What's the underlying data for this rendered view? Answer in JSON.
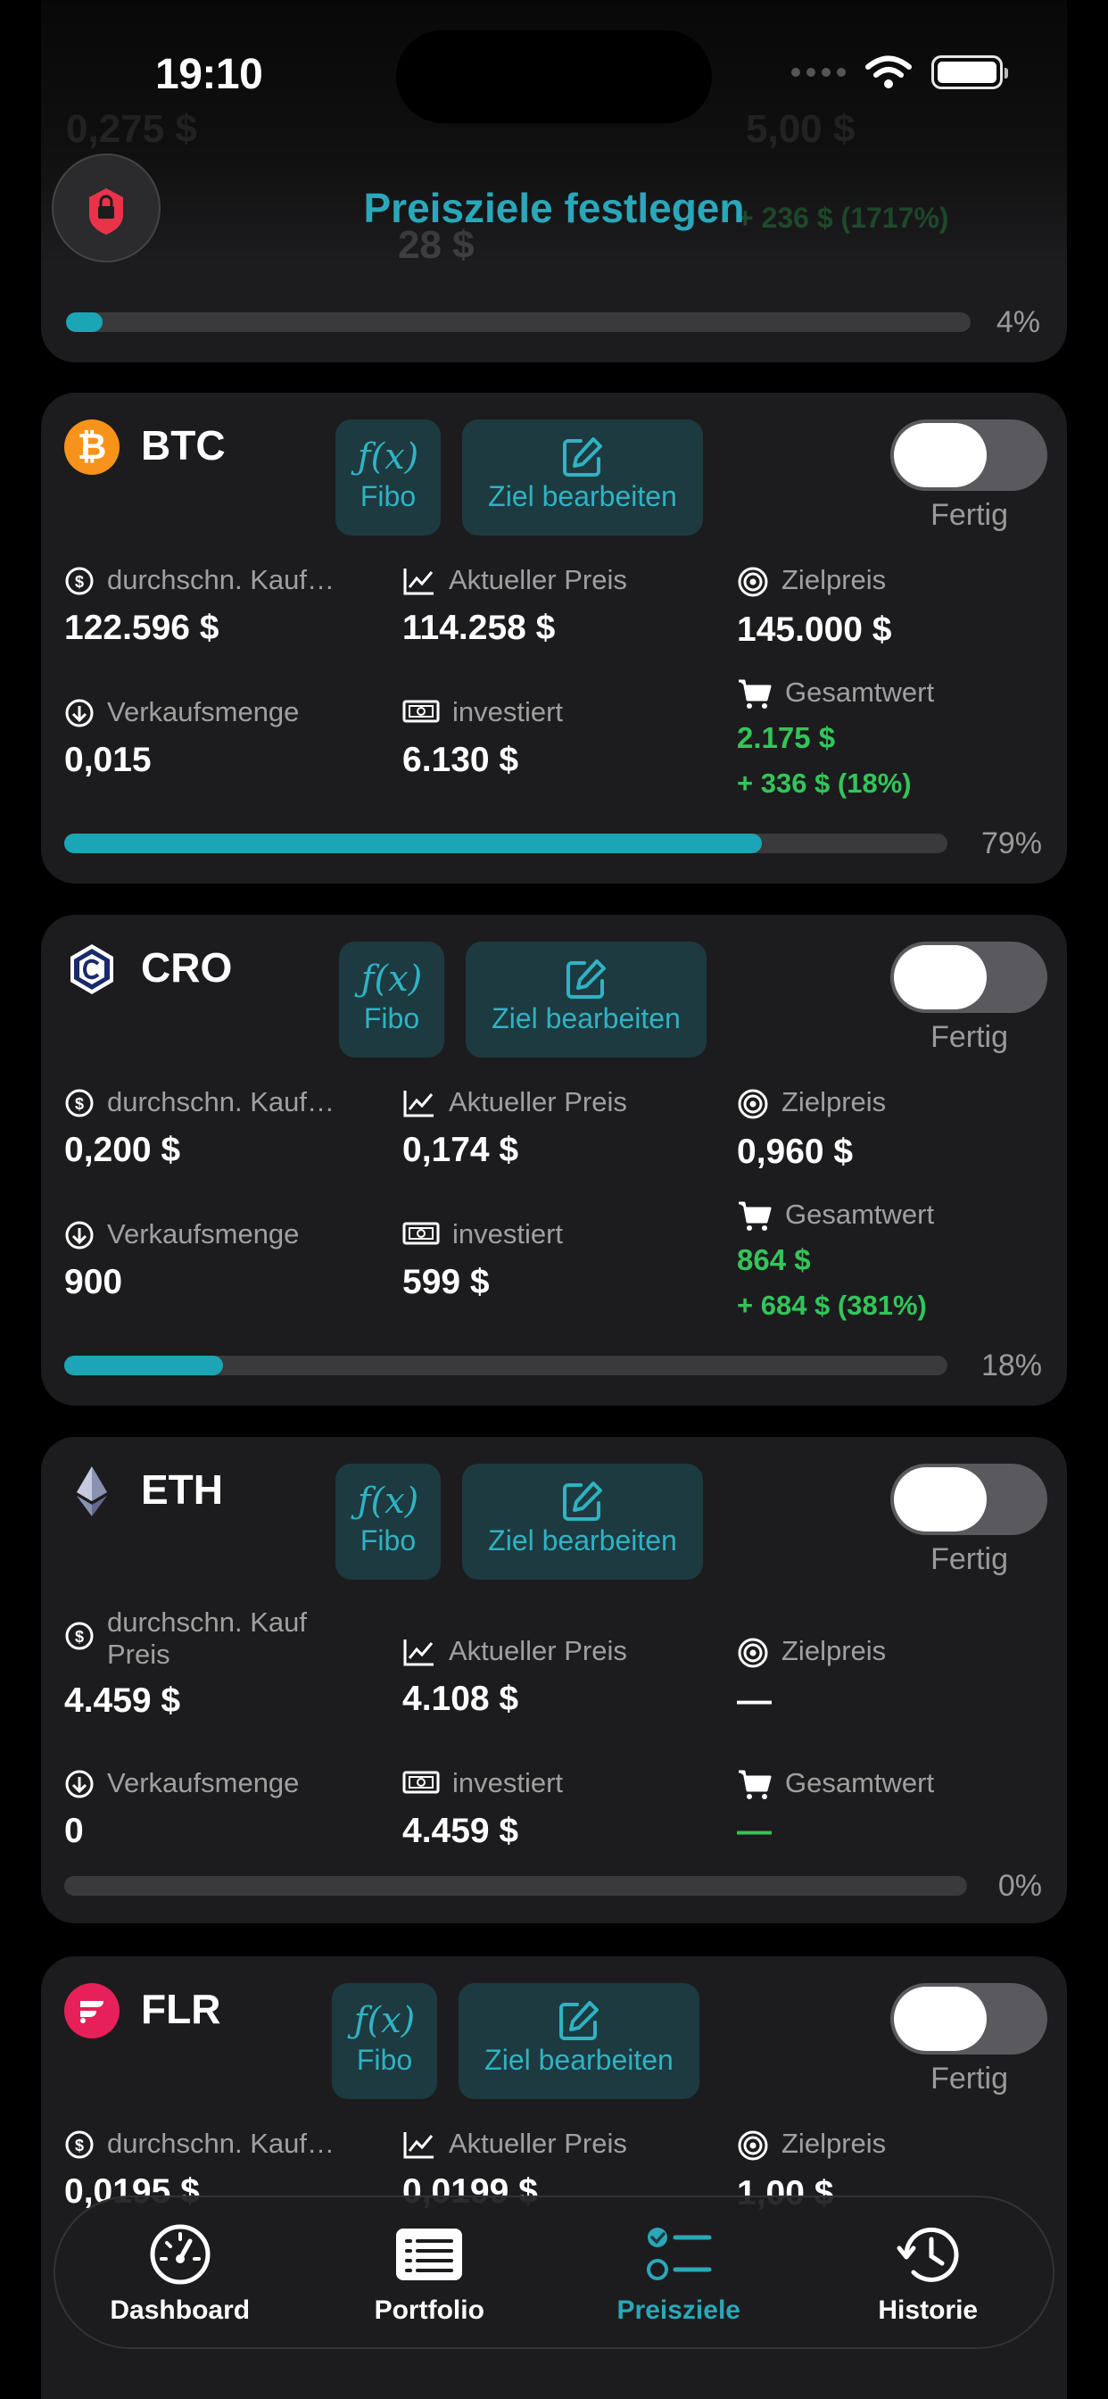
{
  "status": {
    "time": "19:10"
  },
  "header": {
    "title": "Preisziele festlegen",
    "progress_label": "4%",
    "progress_fraction": 0.04
  },
  "labels": {
    "avg_buy": "durchschn. Kauf…",
    "avg_buy_full": "durchschn. Kauf Preis",
    "current_price": "Aktueller Preis",
    "target_price": "Zielpreis",
    "sell_amount": "Verkaufsmenge",
    "invested": "investiert",
    "total_value": "Gesamtwert",
    "fibo": "Fibo",
    "edit_target": "Ziel bearbeiten",
    "done": "Fertig"
  },
  "coins": [
    {
      "symbol": "BTC",
      "avg_buy": "122.596 $",
      "current_price": "114.258 $",
      "target_price": "145.000 $",
      "sell_amount": "0,015",
      "invested": "6.130 $",
      "total_value": "2.175 $",
      "gain": "+ 336 $ (18%)",
      "progress_label": "79%",
      "progress_fraction": 0.79,
      "icon_color": "#f7931a"
    },
    {
      "symbol": "CRO",
      "avg_buy": "0,200 $",
      "current_price": "0,174 $",
      "target_price": "0,960 $",
      "sell_amount": "900",
      "invested": "599 $",
      "total_value": "864 $",
      "gain": "+ 684 $ (381%)",
      "progress_label": "18%",
      "progress_fraction": 0.18,
      "icon_color": "#1a2a6c"
    },
    {
      "symbol": "ETH",
      "avg_buy": "4.459 $",
      "current_price": "4.108 $",
      "target_price": "—",
      "sell_amount": "0",
      "invested": "4.459 $",
      "total_value": "—",
      "progress_label": "0%",
      "progress_fraction": 0,
      "icon_color": "#8a92b2"
    },
    {
      "symbol": "FLR",
      "avg_buy": "0,0195 $",
      "current_price": "0,0199 $",
      "target_price": "1,00 $",
      "icon_color": "#e62058"
    }
  ],
  "tabs": [
    {
      "label": "Dashboard"
    },
    {
      "label": "Portfolio"
    },
    {
      "label": "Preisziele"
    },
    {
      "label": "Historie"
    }
  ]
}
